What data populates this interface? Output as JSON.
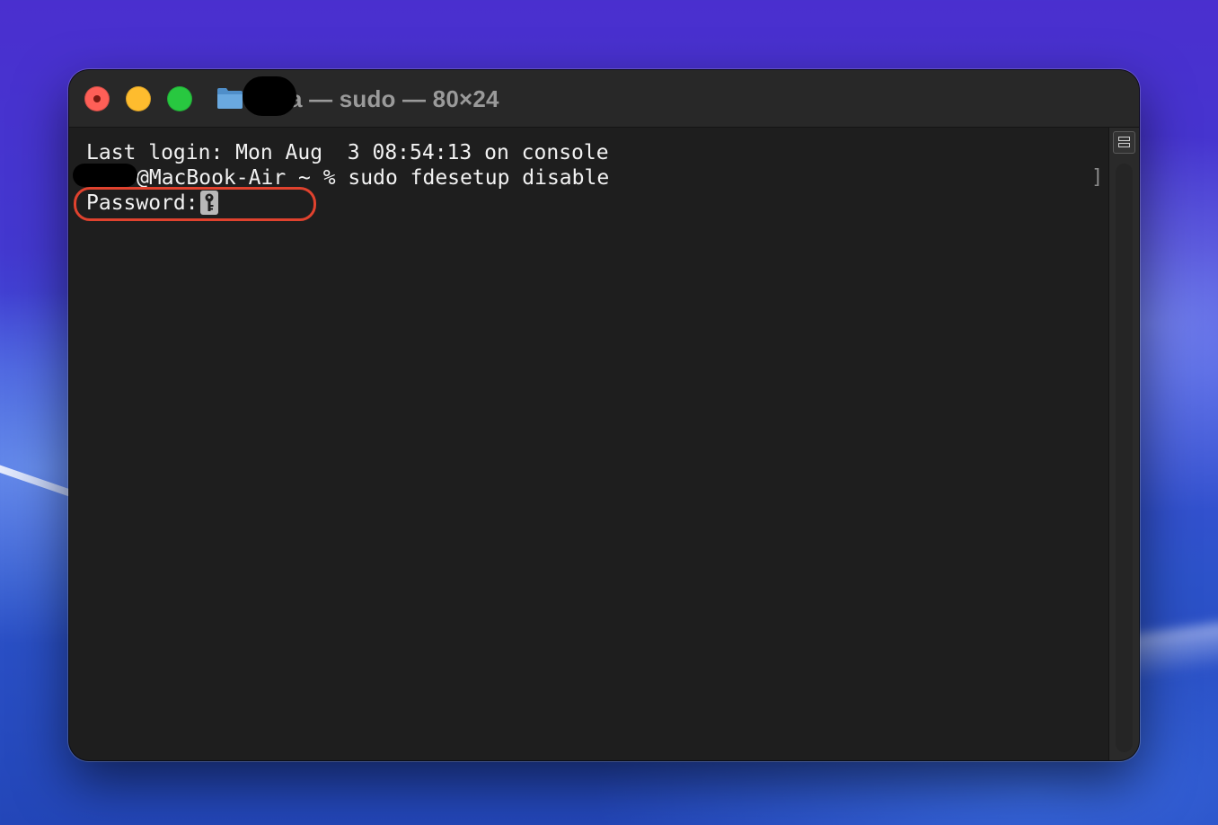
{
  "window": {
    "title": "a — sudo — 80×24",
    "folder_icon": "folder-icon"
  },
  "terminal": {
    "line1": "Last login: Mon Aug  3 08:54:13 on console",
    "line2_prompt": "@MacBook-Air ~ % sudo fdesetup disable",
    "line3_label": "Password:",
    "cursor_icon": "key-icon",
    "bracket_marker": "]"
  },
  "colors": {
    "close": "#fe5f57",
    "minimize": "#febc2e",
    "zoom": "#28c840",
    "highlight": "#e0422e",
    "terminal_bg": "#1e1e1e"
  }
}
